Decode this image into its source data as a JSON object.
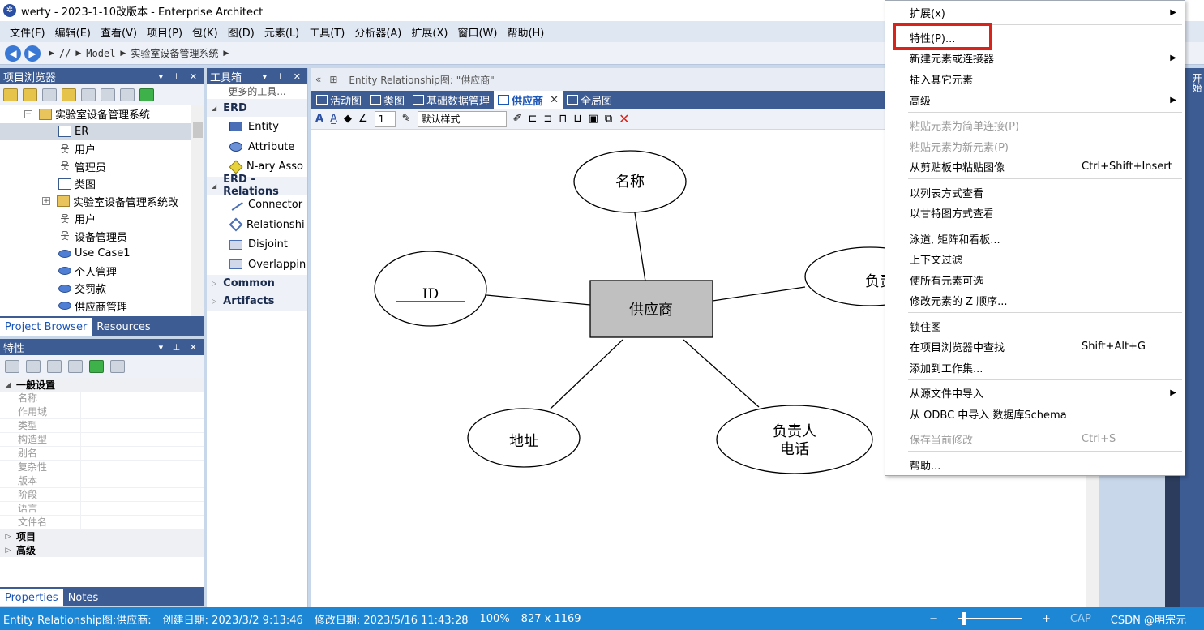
{
  "window": {
    "title": "werty - 2023-1-10改版本 - Enterprise Architect"
  },
  "menubar": [
    "文件(F)",
    "编辑(E)",
    "查看(V)",
    "项目(P)",
    "包(K)",
    "图(D)",
    "元素(L)",
    "工具(T)",
    "分析器(A)",
    "扩展(X)",
    "窗口(W)",
    "帮助(H)"
  ],
  "address": {
    "root": "//",
    "model": "Model",
    "path": "实验室设备管理系统"
  },
  "project_browser": {
    "title": "项目浏览器",
    "items": [
      {
        "label": "实验室设备管理系统",
        "icon": "package-icon"
      },
      {
        "label": "ER",
        "icon": "diagram-icon"
      },
      {
        "label": "用户",
        "icon": "actor-group-icon"
      },
      {
        "label": "管理员",
        "icon": "actor-group-icon"
      },
      {
        "label": "类图",
        "icon": "diagram-icon"
      },
      {
        "label": "实验室设备管理系统改",
        "icon": "folder-icon"
      },
      {
        "label": "用户",
        "icon": "actor-icon"
      },
      {
        "label": "设备管理员",
        "icon": "actor-icon"
      },
      {
        "label": "Use Case1",
        "icon": "usecase-icon"
      },
      {
        "label": "个人管理",
        "icon": "usecase-icon"
      },
      {
        "label": "交罚款",
        "icon": "usecase-icon"
      },
      {
        "label": "供应商管理",
        "icon": "usecase-icon"
      }
    ],
    "tabs": [
      "Project Browser",
      "Resources"
    ]
  },
  "properties": {
    "title": "特性",
    "group_general": "一般设置",
    "rows": [
      "名称",
      "作用域",
      "类型",
      "构造型",
      "别名",
      "复杂性",
      "版本",
      "阶段",
      "语言",
      "文件名"
    ],
    "group_project": "项目",
    "group_advanced": "高级",
    "tabs": [
      "Properties",
      "Notes"
    ]
  },
  "toolbox": {
    "title": "工具箱",
    "more_tools": "更多的工具...",
    "groups": [
      {
        "name": "ERD",
        "items": [
          "Entity",
          "Attribute",
          "N-ary Asso"
        ]
      },
      {
        "name": "ERD - Relations",
        "items": [
          "Connector",
          "Relationshi",
          "Disjoint",
          "Overlappin"
        ]
      },
      {
        "name": "Common",
        "items": []
      },
      {
        "name": "Artifacts",
        "items": []
      }
    ]
  },
  "diagram": {
    "header": "Entity Relationship图: \"供应商\"",
    "tabs": [
      "活动图",
      "类图",
      "基础数据管理",
      "供应商",
      "全局图"
    ],
    "active_tab": "供应商",
    "line_width": "1",
    "style_select": "默认样式",
    "entity": "供应商",
    "attributes": {
      "id": "ID",
      "name": "名称",
      "address": "地址",
      "person_line1": "负责人",
      "person_line2": "电话",
      "partial": "负责"
    }
  },
  "context_menu": {
    "items": [
      {
        "label": "扩展(x)",
        "submenu": true
      },
      {
        "label": "特性(P)...",
        "highlight": true
      },
      {
        "label": "新建元素或连接器",
        "submenu": true
      },
      {
        "label": "插入其它元素"
      },
      {
        "label": "高级",
        "submenu": true
      },
      {
        "label": "粘贴元素为简单连接(P)",
        "disabled": true
      },
      {
        "label": "粘贴元素为新元素(P)",
        "disabled": true
      },
      {
        "label": "从剪贴板中粘贴图像",
        "shortcut": "Ctrl+Shift+Insert"
      },
      {
        "label": "以列表方式查看"
      },
      {
        "label": "以甘特图方式查看"
      },
      {
        "label": "泳道, 矩阵和看板..."
      },
      {
        "label": "上下文过滤"
      },
      {
        "label": "使所有元素可选"
      },
      {
        "label": "修改元素的 Z 顺序..."
      },
      {
        "label": "锁住图"
      },
      {
        "label": "在项目浏览器中查找",
        "shortcut": "Shift+Alt+G"
      },
      {
        "label": "添加到工作集..."
      },
      {
        "label": "从源文件中导入",
        "submenu": true
      },
      {
        "label": "从 ODBC 中导入 数据库Schema"
      },
      {
        "label": "保存当前修改",
        "shortcut": "Ctrl+S",
        "disabled": true
      },
      {
        "label": "帮助..."
      }
    ]
  },
  "right_strip": {
    "label": "开始"
  },
  "statusbar": {
    "diagram": "Entity Relationship图:供应商:",
    "created": "创建日期: 2023/3/2 9:13:46",
    "modified": "修改日期: 2023/5/16 11:43:28",
    "zoom": "100%",
    "size": "827 x 1169",
    "caps": "CAP",
    "watermark": "CSDN @明宗元"
  },
  "colors": {
    "accent": "#3d5c93",
    "status": "#1d87d6",
    "highlight": "#d9241c",
    "entity_fill": "#c0c0c0"
  }
}
